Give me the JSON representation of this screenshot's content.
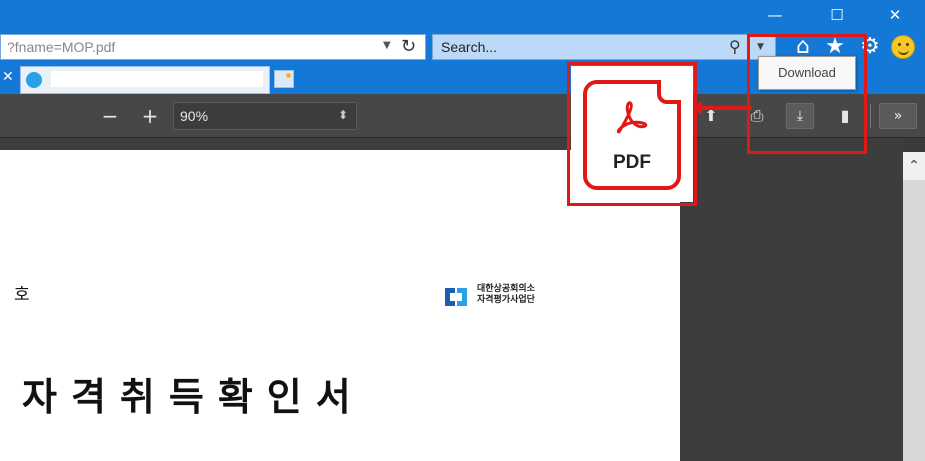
{
  "browser": {
    "address_text": "?fname=MOP.pdf",
    "search_placeholder": "Search...",
    "window_controls": {
      "minimize": "—",
      "maximize": "☐",
      "close": "✕"
    }
  },
  "tab": {
    "close_glyph": "✕",
    "title": ""
  },
  "pdf_toolbar": {
    "zoom_out": "−",
    "zoom_in": "+",
    "zoom_value": "90%",
    "zoom_arrows": "⬍",
    "more": "»"
  },
  "tooltip": {
    "text": "Download"
  },
  "annotation": {
    "pdf_label": "PDF",
    "color": "#e01818"
  },
  "document": {
    "ho": "호",
    "logo_line1": "대한상공회의소",
    "logo_line2": "자격평가사업단",
    "title": "자격취득확인서"
  },
  "scrollbar": {
    "up": "⌃"
  },
  "icons": [
    "dropdown-arrow-icon",
    "refresh-icon",
    "search-icon",
    "home-icon",
    "star-icon",
    "gear-icon",
    "smiley-icon",
    "tab-favicon-icon",
    "new-tab-icon",
    "rotate-icon",
    "print-icon",
    "download-icon",
    "bookmark-icon",
    "pdf-file-icon",
    "arrow-icon"
  ]
}
